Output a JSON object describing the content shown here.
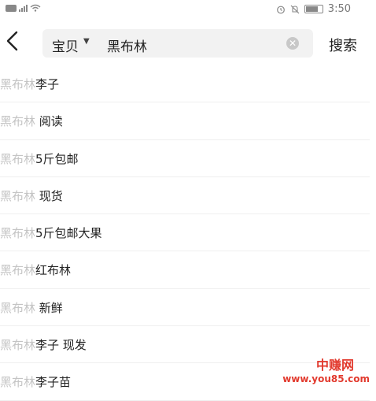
{
  "status_bar": {
    "time": "3:50"
  },
  "header": {
    "scope": "宝贝",
    "query": "黑布林",
    "search_label": "搜索"
  },
  "suggestions": [
    {
      "prefix": "黑布林",
      "suffix": "李子"
    },
    {
      "prefix": "黑布林",
      "suffix": " 阅读"
    },
    {
      "prefix": "黑布林",
      "suffix": "5斤包邮"
    },
    {
      "prefix": "黑布林",
      "suffix": " 现货"
    },
    {
      "prefix": "黑布林",
      "suffix": "5斤包邮大果"
    },
    {
      "prefix": "黑布林",
      "suffix": "红布林"
    },
    {
      "prefix": "黑布林",
      "suffix": " 新鲜"
    },
    {
      "prefix": "黑布林",
      "suffix": "李子 现发"
    },
    {
      "prefix": "黑布林",
      "suffix": "李子苗"
    }
  ],
  "watermark": {
    "name": "中赚网",
    "url": "www.you85.com"
  },
  "colors": {
    "accent": "#e23a2e",
    "hint": "#c4c4c4",
    "box": "#f2f2f2"
  }
}
